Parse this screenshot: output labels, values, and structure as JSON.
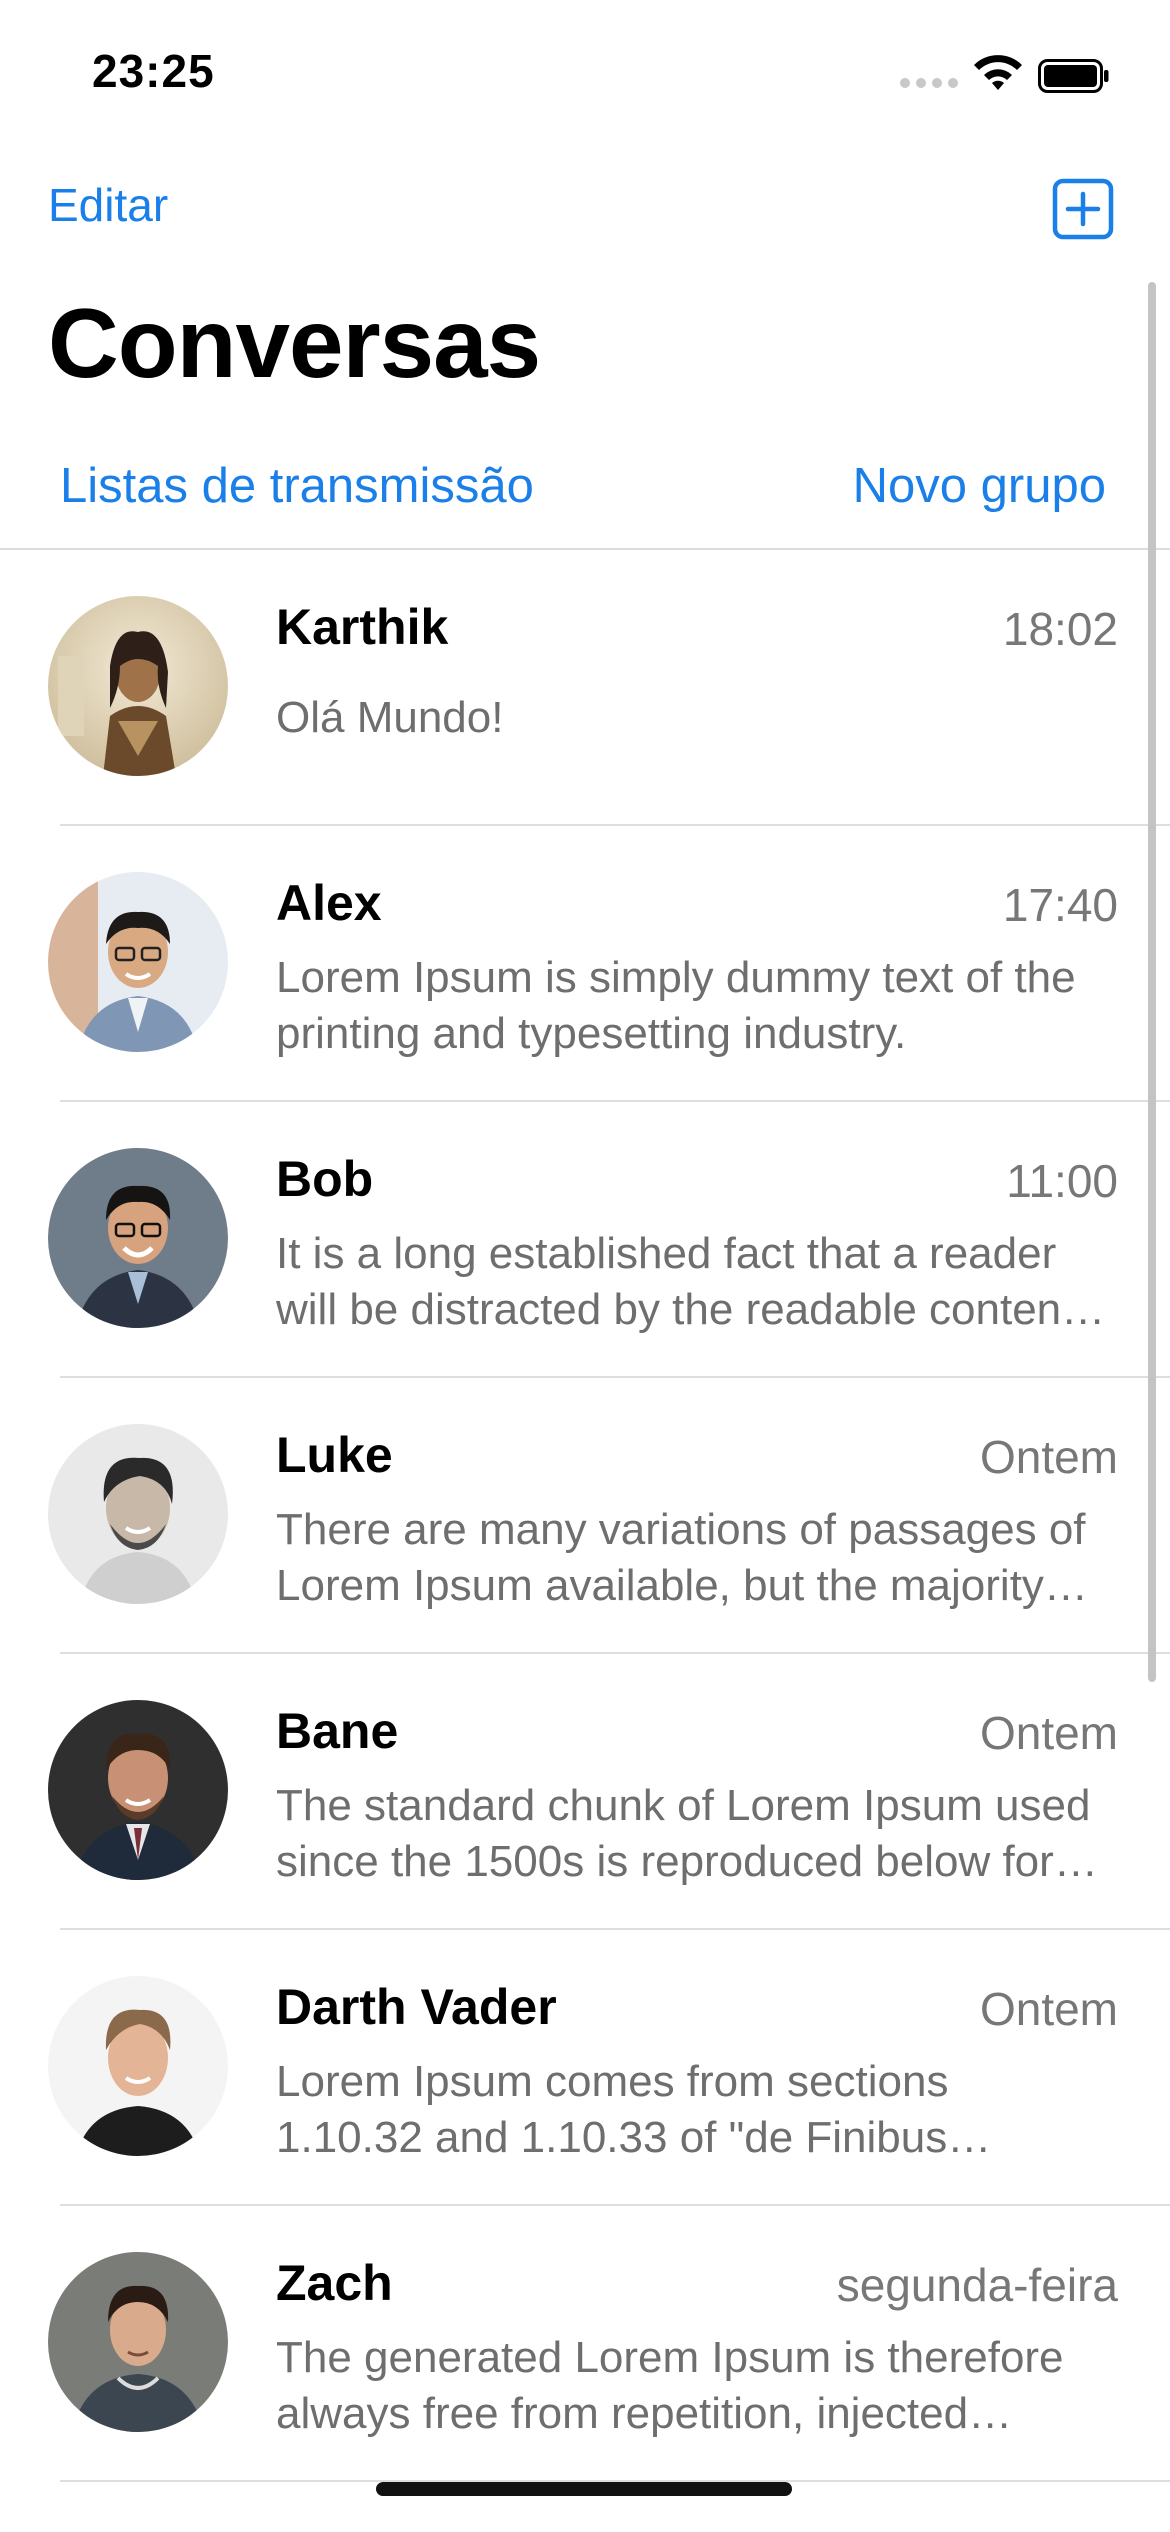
{
  "status_bar": {
    "time": "23:25"
  },
  "nav": {
    "edit_label": "Editar",
    "compose_icon": "square-plus-icon"
  },
  "page": {
    "title": "Conversas",
    "broadcast_label": "Listas de transmissão",
    "new_group_label": "Novo grupo"
  },
  "colors": {
    "accent": "#1a7fe8"
  },
  "chats": [
    {
      "name": "Karthik",
      "time": "18:02",
      "preview": "Olá Mundo!"
    },
    {
      "name": "Alex",
      "time": "17:40",
      "preview": "Lorem Ipsum is simply dummy text of the printing and typesetting industry."
    },
    {
      "name": "Bob",
      "time": "11:00",
      "preview": "It is a long established fact that a reader will be distracted by the readable content of a page when looking at its layout."
    },
    {
      "name": "Luke",
      "time": "Ontem",
      "preview": "There are many variations of passages of Lorem Ipsum available, but the majority have suffered alteration in some form."
    },
    {
      "name": "Bane",
      "time": "Ontem",
      "preview": "The standard chunk of Lorem Ipsum used since the 1500s is reproduced below for those interested."
    },
    {
      "name": "Darth Vader",
      "time": "Ontem",
      "preview": "Lorem Ipsum comes from sections 1.10.32 and 1.10.33 of \"de Finibus Bonorum et Malorum\" by Cicero."
    },
    {
      "name": "Zach",
      "time": "segunda-feira",
      "preview": "The generated Lorem Ipsum is therefore always free from repetition, injected humour, or non-characteristic words."
    }
  ]
}
